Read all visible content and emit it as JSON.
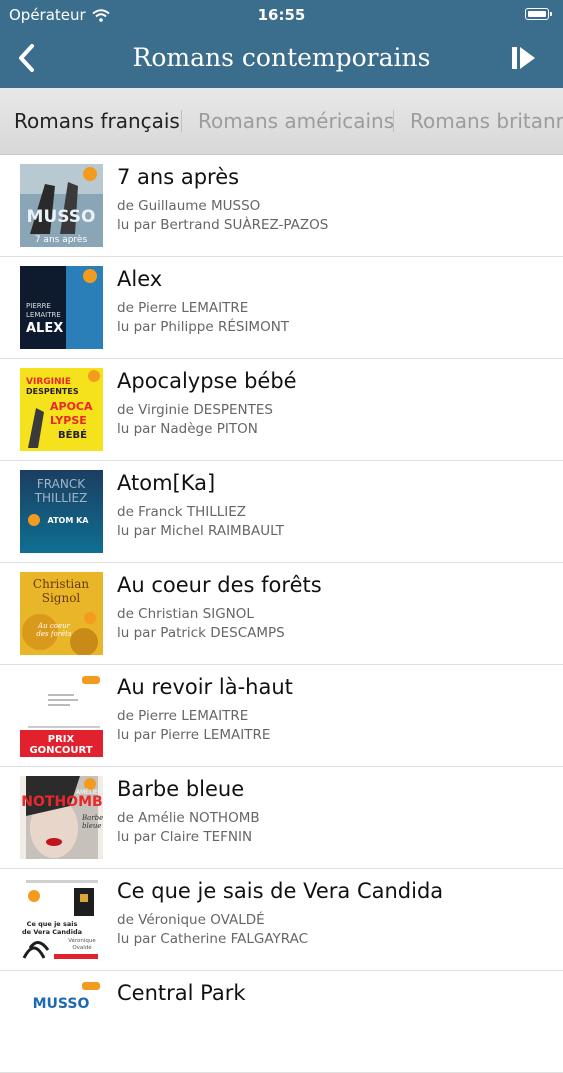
{
  "status_bar": {
    "carrier": "Opérateur",
    "time": "16:55"
  },
  "nav": {
    "title": "Romans contemporains"
  },
  "tabs": [
    "Romans français",
    "Romans américains",
    "Romans britanniques"
  ],
  "books": [
    {
      "title": "7 ans après",
      "author": "de Guillaume  MUSSO",
      "reader": "lu par Bertrand SUÀREZ-PAZOS",
      "cover": [
        "MUSSO",
        "7 ans après"
      ]
    },
    {
      "title": "Alex",
      "author": "de Pierre LEMAITRE",
      "reader": "lu par Philippe RÉSIMONT",
      "cover": [
        "PIERRE",
        "LEMAITRE",
        "ALEX"
      ]
    },
    {
      "title": "Apocalypse bébé",
      "author": "de Virginie DESPENTES",
      "reader": "lu par Nadège PITON",
      "cover": [
        "VIRGINIE",
        "DESPENTES",
        "APOCA",
        "LYPSE",
        "BÉBÉ"
      ]
    },
    {
      "title": "Atom[Ka]",
      "author": "de Franck THILLIEZ",
      "reader": "lu par Michel RAIMBAULT",
      "cover": [
        "FRANCK",
        "THILLIEZ",
        "ATOM KA"
      ]
    },
    {
      "title": "Au coeur des forêts",
      "author": "de Christian SIGNOL",
      "reader": "lu par Patrick DESCAMPS",
      "cover": [
        "Christian",
        "Signol",
        "Au coeur",
        "des forêts"
      ]
    },
    {
      "title": "Au revoir là-haut",
      "author": "de Pierre LEMAITRE",
      "reader": "lu par Pierre LEMAITRE",
      "cover": [
        "PRIX",
        "GONCOURT"
      ]
    },
    {
      "title": "Barbe bleue",
      "author": "de Amélie NOTHOMB",
      "reader": "lu par Claire TEFNIN",
      "cover": [
        "AMÉLIE",
        "NOTHOMB",
        "Barbe",
        "bleue"
      ]
    },
    {
      "title": "Ce que je sais de Vera Candida",
      "author": "de Véronique OVALDÉ",
      "reader": "lu par Catherine FALGAYRAC",
      "cover": [
        "Ce que je sais",
        "de Vera Candida",
        "Véronique",
        "Ovaldé"
      ]
    },
    {
      "title": "Central Park",
      "author": "",
      "reader": "",
      "cover": [
        "MUSSO"
      ]
    }
  ],
  "colors": {
    "header": "#3b6e8d",
    "tab_bar": "#dddddd",
    "badge": "#f39b1f"
  },
  "icons": {
    "back": "chevron-left-icon",
    "play": "play-pause-icon",
    "wifi": "wifi-icon",
    "battery": "battery-icon"
  }
}
